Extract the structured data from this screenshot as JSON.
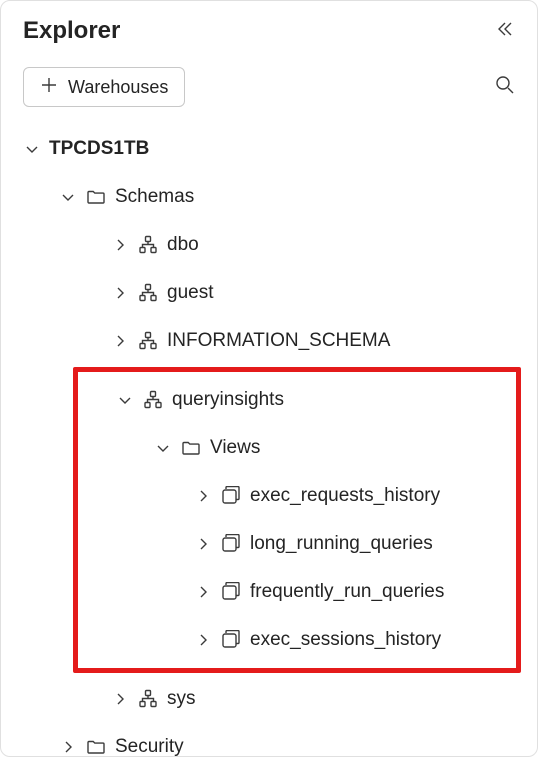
{
  "header": {
    "title": "Explorer"
  },
  "toolbar": {
    "add_button_label": "Warehouses"
  },
  "tree": {
    "database": {
      "label": "TPCDS1TB",
      "expanded": true
    },
    "schemas_folder": {
      "label": "Schemas",
      "expanded": true
    },
    "schemas": {
      "dbo": {
        "label": "dbo"
      },
      "guest": {
        "label": "guest"
      },
      "info": {
        "label": "INFORMATION_SCHEMA"
      },
      "queryinsights": {
        "label": "queryinsights",
        "expanded": true
      },
      "sys": {
        "label": "sys"
      }
    },
    "views_folder": {
      "label": "Views",
      "expanded": true
    },
    "views": {
      "v0": {
        "label": "exec_requests_history"
      },
      "v1": {
        "label": "long_running_queries"
      },
      "v2": {
        "label": "frequently_run_queries"
      },
      "v3": {
        "label": "exec_sessions_history"
      }
    },
    "security_folder": {
      "label": "Security"
    }
  }
}
